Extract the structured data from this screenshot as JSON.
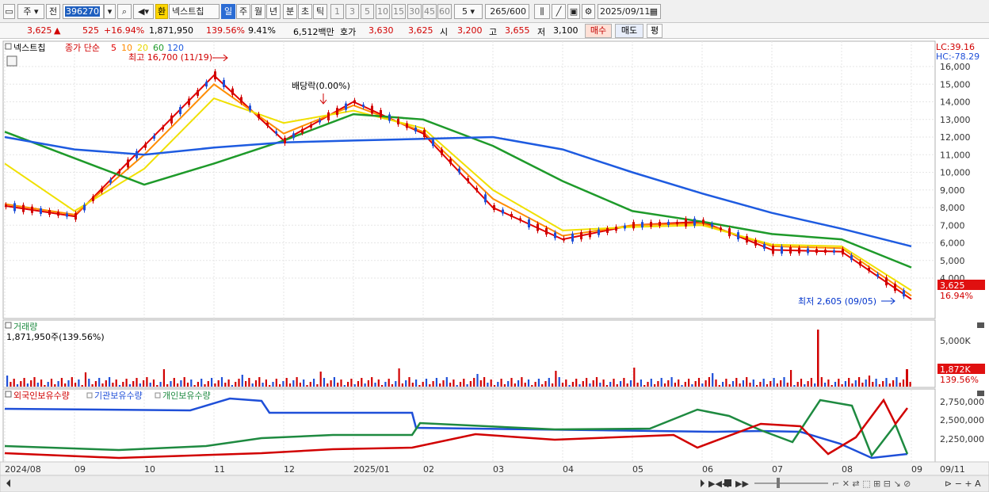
{
  "toolbar": {
    "period_prefix": "주",
    "prev_label": "전",
    "stock_code": "396270",
    "stock_name": "넥스트칩",
    "hwan_label": "환",
    "period_tabs": [
      "일",
      "주",
      "월",
      "년",
      "분",
      "초",
      "틱"
    ],
    "selected_period": "일",
    "interval_buttons": [
      "1",
      "3",
      "5",
      "10",
      "15",
      "30",
      "45",
      "60"
    ],
    "interval_value": "5",
    "count_current": "265",
    "count_max": "/600",
    "date": "2025/09/11"
  },
  "quote": {
    "price": "3,625",
    "change": "525",
    "change_pct": "+16.94%",
    "volume": "1,871,950",
    "volume_ratio": "139.56%",
    "turnover": "9.41%",
    "amount": "6,512백만",
    "bid_label": "호가",
    "ask": "3,630",
    "bid": "3,625",
    "open_label": "시",
    "open": "3,200",
    "high_label": "고",
    "high": "3,655",
    "low_label": "저",
    "low": "3,100",
    "buy_label": "매수",
    "sell_label": "매도",
    "eval_label": "평"
  },
  "price_panel": {
    "title": "넥스트칩",
    "ma_label": "종가 단순",
    "ma_periods": [
      "5",
      "10",
      "20",
      "60",
      "120"
    ],
    "lc": "LC:39.16",
    "hc": "HC:-78.29",
    "high_annotation": "최고 16,700 (11/19)",
    "dividend_annotation": "배당락(0.00%)",
    "low_annotation": "최저 2,605 (09/05)",
    "price_tag": "3,625",
    "pct_tag": "16.94%",
    "y_ticks": [
      "16,000",
      "15,000",
      "14,000",
      "13,000",
      "12,000",
      "11,000",
      "10,000",
      "9,000",
      "8,000",
      "7,000",
      "6,000",
      "5,000",
      "4,000"
    ]
  },
  "volume_panel": {
    "title": "거래량",
    "value": "1,871,950주(139.56%)",
    "y_tick": "5,000K",
    "tag": "1,872K",
    "tag_pct": "139.56%"
  },
  "holding_panel": {
    "series_labels": [
      "외국인보유수량",
      "기관보유수량",
      "개인보유수량"
    ],
    "y_ticks": [
      "2,750,000",
      "2,500,000",
      "2,250,000"
    ]
  },
  "x_axis": {
    "labels": [
      "2024/08",
      "09",
      "10",
      "11",
      "12",
      "2025/01",
      "02",
      "03",
      "04",
      "05",
      "06",
      "07",
      "08",
      "09"
    ],
    "last_label": "09/11"
  },
  "colors": {
    "up": "#d10000",
    "down": "#1f4fd8",
    "ma5": "#e00000",
    "ma10": "#ff8c00",
    "ma20": "#f0e000",
    "ma60": "#1e9a2a",
    "ma120": "#1e5be0"
  },
  "chart_data": {
    "type": "line",
    "x": [
      "2024/08",
      "09",
      "10",
      "11",
      "12",
      "2025/01",
      "02",
      "03",
      "04",
      "05",
      "06",
      "07",
      "08",
      "09"
    ],
    "series": [
      {
        "name": "5",
        "values": [
          8100,
          7500,
          11500,
          15500,
          11800,
          14000,
          12200,
          8000,
          6200,
          7000,
          7200,
          5600,
          5500,
          2800
        ]
      },
      {
        "name": "10",
        "values": [
          8200,
          7600,
          11000,
          15000,
          12200,
          13800,
          12300,
          8500,
          6400,
          7000,
          7100,
          5800,
          5700,
          3000
        ]
      },
      {
        "name": "20",
        "values": [
          10500,
          7800,
          10200,
          14200,
          12800,
          13500,
          12500,
          9000,
          6700,
          6900,
          7000,
          5900,
          5800,
          3300
        ]
      },
      {
        "name": "60",
        "values": [
          12300,
          10800,
          9300,
          10500,
          11800,
          13300,
          13000,
          11500,
          9500,
          7800,
          7200,
          6500,
          6200,
          4600
        ]
      },
      {
        "name": "120",
        "values": [
          12000,
          11300,
          11000,
          11400,
          11700,
          11800,
          11900,
          12000,
          11300,
          10000,
          8800,
          7700,
          6800,
          5800
        ]
      }
    ],
    "ylim": [
      2500,
      16800
    ]
  }
}
